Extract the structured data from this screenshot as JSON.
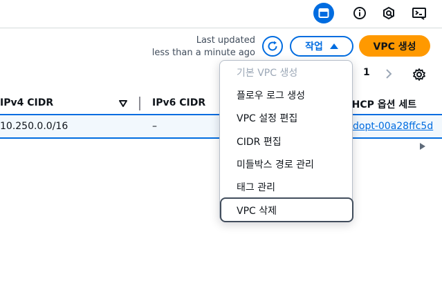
{
  "topbar": {
    "icons": [
      "active-panel-icon",
      "info-icon",
      "extension-icon",
      "terminal-icon"
    ]
  },
  "toolbar": {
    "last_updated_line1": "Last updated",
    "last_updated_line2": "less than a minute ago",
    "actions_label": "작업",
    "create_label": "VPC 생성"
  },
  "pagination": {
    "current_page": "1"
  },
  "table": {
    "columns": [
      "IPv4 CIDR",
      "IPv6 CIDR",
      "DHCP 옵션 세트"
    ],
    "rows": [
      {
        "ipv4": "10.250.0.0/16",
        "ipv6": "–",
        "dhcp": "dopt-00a28ffc5d"
      }
    ]
  },
  "menu": {
    "items": [
      {
        "label": "기본 VPC 생성",
        "disabled": true
      },
      {
        "label": "플로우 로그 생성"
      },
      {
        "label": "VPC 설정 편집"
      },
      {
        "label": "CIDR 편집"
      },
      {
        "label": "미들박스 경로 관리"
      },
      {
        "label": "태그 관리"
      },
      {
        "label": "VPC 삭제",
        "focused": true
      }
    ]
  },
  "colors": {
    "accent": "#006ce0",
    "primary_button": "#ff9900"
  }
}
